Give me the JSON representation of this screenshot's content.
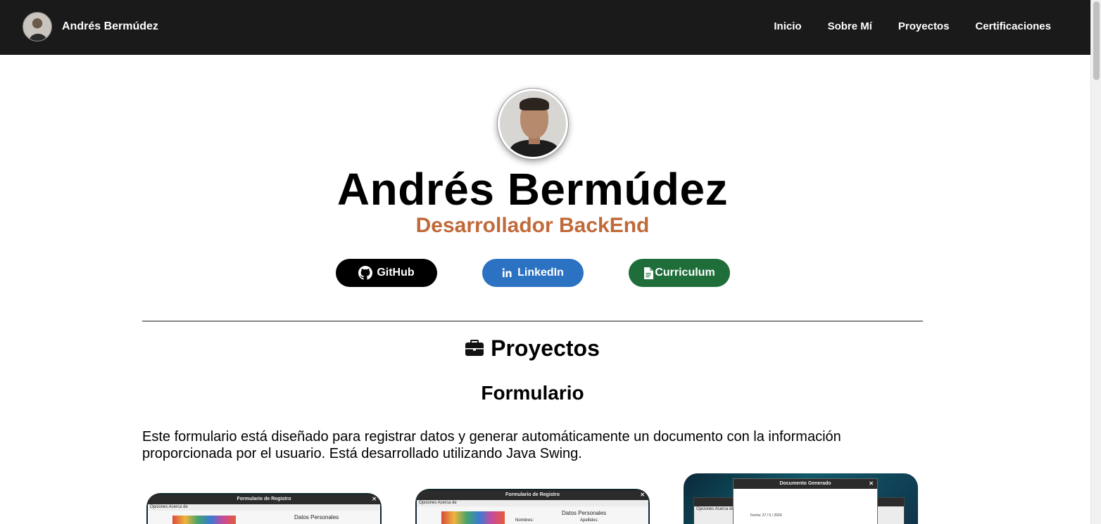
{
  "navbar": {
    "brand_name": "Andrés Bermúdez",
    "links": [
      "Inicio",
      "Sobre Mí",
      "Proyectos",
      "Certificaciones"
    ]
  },
  "hero": {
    "name": "Andrés Bermúdez",
    "role": "Desarrollador BackEnd",
    "buttons": {
      "github": "GitHub",
      "linkedin": "LinkedIn",
      "cv": "Curriculum"
    }
  },
  "projects": {
    "section_title": "Proyectos",
    "items": [
      {
        "title": "Formulario",
        "description": "Este formulario está diseñado para registrar datos y generar automáticamente un documento con la información proporcionada por el usuario. Está desarrollado utilizando Java Swing.",
        "screenshots": [
          {
            "window_title": "Formulario de Registro",
            "menu": "Opciones   Acerca de",
            "section": "Datos Personales"
          },
          {
            "window_title": "Formulario de Registro",
            "menu": "Opciones   Acerca de",
            "section": "Datos Personales",
            "field_1": "Nombres:",
            "field_2": "Apellidos:"
          },
          {
            "window_title": "Documento Generado",
            "back_menu": "Opciones   Acerca de",
            "date": "Fecha: 27 / 5 / 2024"
          }
        ]
      }
    ]
  },
  "colors": {
    "navbar_bg": "#1a1a1a",
    "role_accent": "#c06a3a",
    "github_btn": "#000000",
    "linkedin_btn": "#2c72c3",
    "cv_btn": "#1f6e3a"
  },
  "icons": {
    "github": "github-icon",
    "linkedin": "linkedin-icon",
    "cv": "document-icon",
    "section": "briefcase-icon"
  }
}
